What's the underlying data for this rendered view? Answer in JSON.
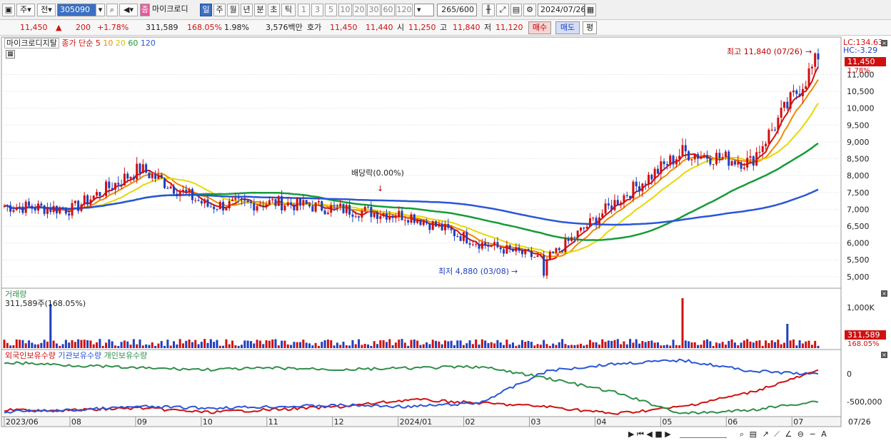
{
  "toolbar": {
    "stock_code": "305090",
    "stock_name": "마이크로디",
    "label_ju": "주",
    "label_jeon": "전",
    "badge": "종",
    "periods": [
      "일",
      "주",
      "월",
      "년",
      "분",
      "초",
      "틱"
    ],
    "active_period": "일",
    "ticks": [
      "1",
      "3",
      "5",
      "10",
      "20",
      "30",
      "60",
      "120"
    ],
    "count": "265",
    "count_total": "/600",
    "date": "2024/07/26"
  },
  "info": {
    "price": "11,450",
    "arrow": "▲",
    "change": "200",
    "change_pct": "+1.78%",
    "volume": "311,589",
    "volume_ratio": "168.05%",
    "turnover": "1.98%",
    "amount": "3,576백만",
    "quote_label": "호가",
    "ask": "11,450",
    "bid": "11,440",
    "open_label": "시",
    "open": "11,250",
    "high_label": "고",
    "high": "11,840",
    "low_label": "저",
    "low": "11,120",
    "buy": "매수",
    "sell": "매도",
    "eval": "평"
  },
  "price_panel": {
    "title": "마이크로디지탈",
    "ma_label": "종가 단순",
    "ma_periods": [
      "5",
      "10",
      "20",
      "60",
      "120"
    ],
    "ma_colors": [
      "#d01010",
      "#f08a00",
      "#e6d800",
      "#179b3a",
      "#2a56d8"
    ],
    "lc": "LC:134.63",
    "hc": "HC:-3.29",
    "current_price": "11,450",
    "current_pct": "1.78%",
    "high_annot": "최고 11,840 (07/26)",
    "low_annot": "최저 4,880 (03/08)",
    "dividend": "배당락(0.00%)",
    "y_ticks": [
      "11,000",
      "10,500",
      "10,000",
      "9,500",
      "9,000",
      "8,500",
      "8,000",
      "7,500",
      "7,000",
      "6,500",
      "6,000",
      "5,500",
      "5,000"
    ]
  },
  "volume_panel": {
    "title": "거래량",
    "value": "311,589주(168.05%)",
    "y_tick": "1,000K",
    "badge_value": "311,589",
    "badge_pct": "168.05%"
  },
  "holding_panel": {
    "labels": [
      "외국인보유수량",
      "기관보유수량",
      "개인보유수량"
    ],
    "colors": [
      "#d01010",
      "#2a56d8",
      "#2f8f4a"
    ],
    "y_ticks": [
      "0",
      "-500,000"
    ]
  },
  "x_axis": {
    "labels": [
      "2023/06",
      "08",
      "09",
      "10",
      "11",
      "12",
      "2024/01",
      "02",
      "03",
      "04",
      "05",
      "06",
      "07"
    ],
    "right_label": "07/26"
  },
  "chart_data": {
    "type": "candlestick",
    "title": "마이크로디지탈",
    "y_range": [
      4700,
      11900
    ],
    "high": 11840,
    "low": 4880,
    "last_close": 11450,
    "ma_series": [
      "5",
      "10",
      "20",
      "60",
      "120"
    ],
    "monthly_closes": [
      {
        "month": "2023/06",
        "close": 7100
      },
      {
        "month": "08",
        "close": 7000
      },
      {
        "month": "09",
        "close": 8200
      },
      {
        "month": "10",
        "close": 7100
      },
      {
        "month": "11",
        "close": 7200
      },
      {
        "month": "12",
        "close": 7000
      },
      {
        "month": "2024/01",
        "close": 6800
      },
      {
        "month": "02",
        "close": 6000
      },
      {
        "month": "03",
        "close": 5500
      },
      {
        "month": "04",
        "close": 7200
      },
      {
        "month": "05",
        "close": 8700
      },
      {
        "month": "06",
        "close": 8400
      },
      {
        "month": "07",
        "close": 11450
      }
    ]
  }
}
